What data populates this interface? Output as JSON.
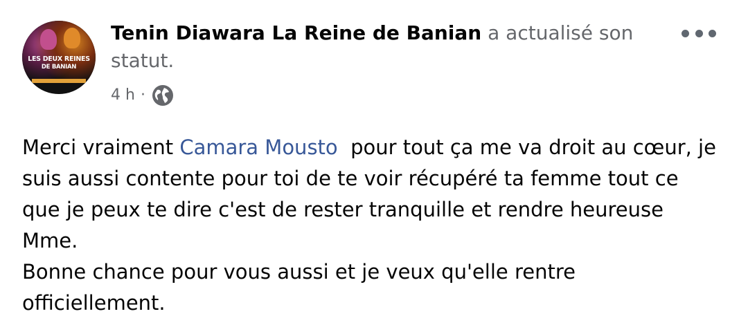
{
  "post": {
    "author": "Tenin Diawara La Reine de Banian",
    "action": "a actualisé son statut.",
    "time": "4 h",
    "separator": "·",
    "privacy_icon": "globe-icon",
    "more_icon": "more-options-icon",
    "avatar": {
      "line1": "LES DEUX REINES",
      "line2": "DE BANIAN"
    },
    "body": {
      "intro": "Merci vraiment ",
      "mention": "Camara Mousto",
      "line1_rest": "  pour tout ça me va droit au cœur, je",
      "line2": "suis aussi contente pour toi de te voir récupéré ta femme tout ce",
      "line3": "que je peux te dire c'est de rester tranquille et rendre heureuse",
      "line4": "Mme.",
      "line5": "Bonne chance pour vous aussi et je veux qu'elle rentre",
      "line6": "officiellement."
    }
  },
  "colors": {
    "text": "#050505",
    "secondary": "#65676b",
    "mention": "#385898",
    "background": "#ffffff"
  }
}
